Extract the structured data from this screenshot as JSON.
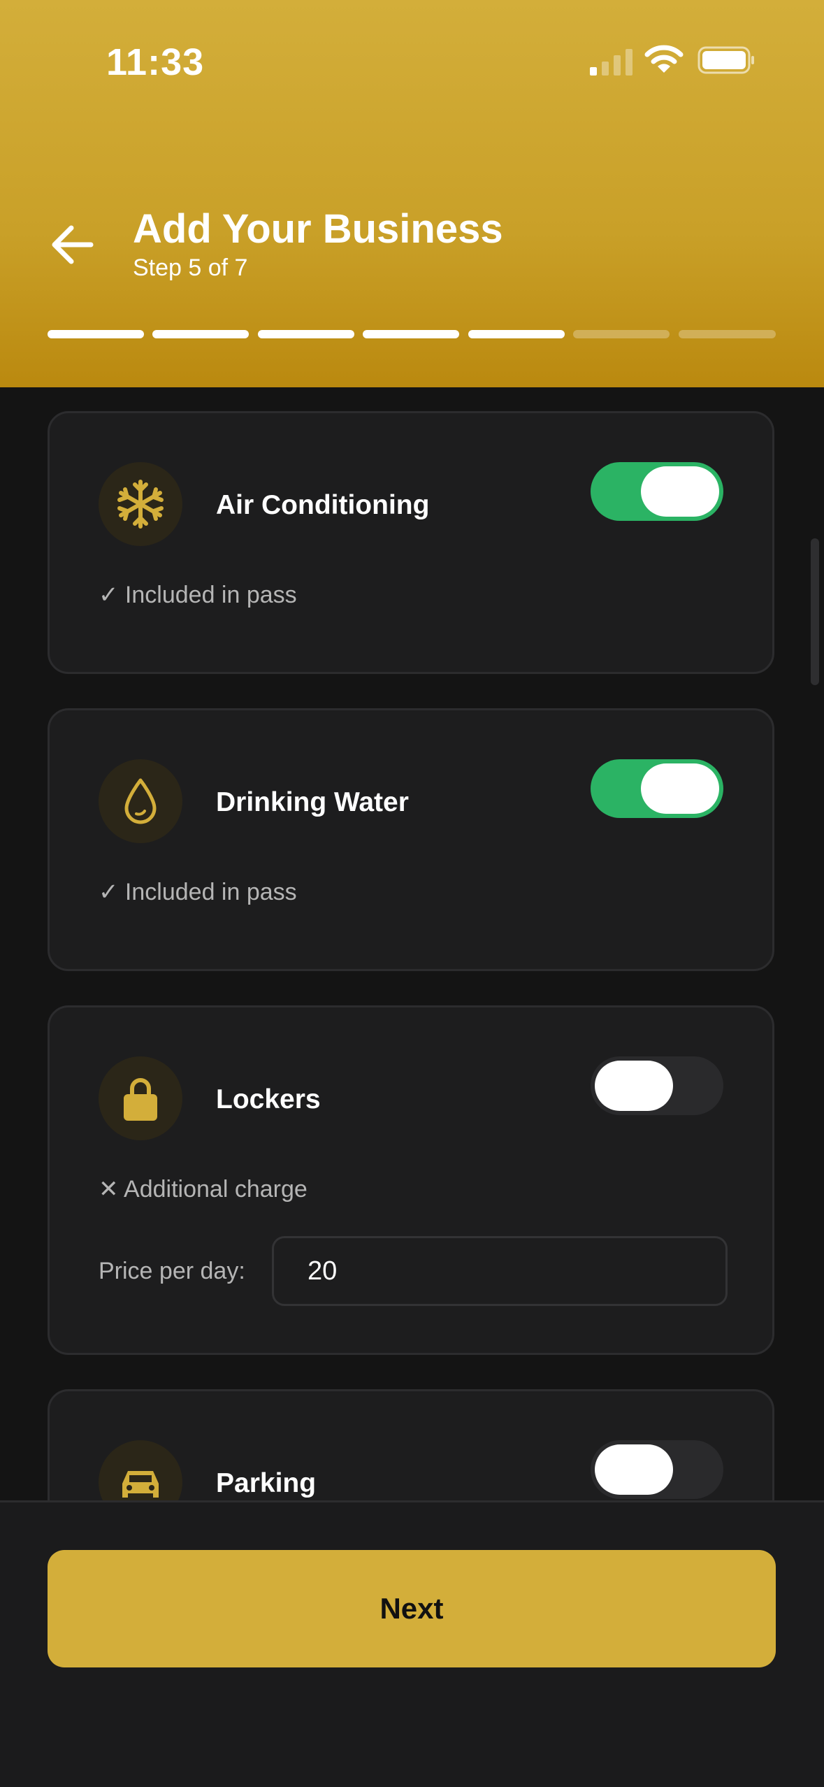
{
  "status_bar": {
    "time": "11:33"
  },
  "header": {
    "title": "Add Your Business",
    "subtitle": "Step 5 of 7",
    "progress": {
      "completed": 5,
      "total": 7
    }
  },
  "amenities": [
    {
      "name": "Air Conditioning",
      "icon": "snowflake-icon",
      "enabled": true,
      "status": "✓ Included in pass"
    },
    {
      "name": "Drinking Water",
      "icon": "water-drop-icon",
      "enabled": true,
      "status": "✓ Included in pass"
    },
    {
      "name": "Lockers",
      "icon": "lock-icon",
      "enabled": false,
      "status": "✕ Additional charge",
      "price_label": "Price per day:",
      "price_value": "20"
    },
    {
      "name": "Parking",
      "icon": "car-icon",
      "enabled": false
    }
  ],
  "footer": {
    "next_label": "Next"
  },
  "colors": {
    "accent": "#D3AE3A",
    "toggle_on": "#2BB364",
    "background": "#141414",
    "card": "#1D1D1E"
  }
}
